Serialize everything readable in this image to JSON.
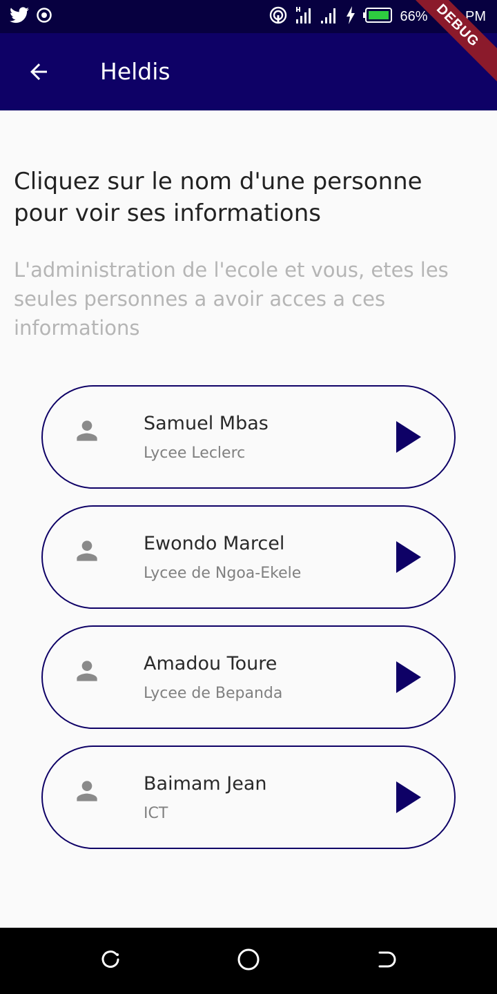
{
  "status_bar": {
    "left_icons": [
      "twitter-icon",
      "record-icon"
    ],
    "right_icons": [
      "hotspot-icon",
      "signal-h-plus-icon",
      "signal-icon",
      "charging-icon",
      "battery-icon"
    ],
    "battery": "66%",
    "time": "7:43 PM",
    "debug_label": "DEBUG"
  },
  "app_bar": {
    "title": "Heldis",
    "back_icon": "arrow-back-icon"
  },
  "content": {
    "heading": "Cliquez sur le nom d'une personne pour voir ses informations",
    "subheading": "L'administration de l'ecole et vous, etes les seules personnes a avoir acces a ces informations"
  },
  "people": [
    {
      "name": "Samuel Mbas",
      "school": "Lycee Leclerc"
    },
    {
      "name": "Ewondo Marcel",
      "school": "Lycee de Ngoa-Ekele"
    },
    {
      "name": "Amadou Toure",
      "school": "Lycee de Bepanda"
    },
    {
      "name": "Baimam Jean",
      "school": "ICT"
    }
  ],
  "colors": {
    "status_bar": "#070040",
    "app_bar": "#0e0166",
    "accent": "#0e0166",
    "person_icon": "#8a8a8a"
  },
  "nav_bar": {
    "icons": [
      "recents-icon",
      "home-icon",
      "back-nav-icon"
    ]
  }
}
